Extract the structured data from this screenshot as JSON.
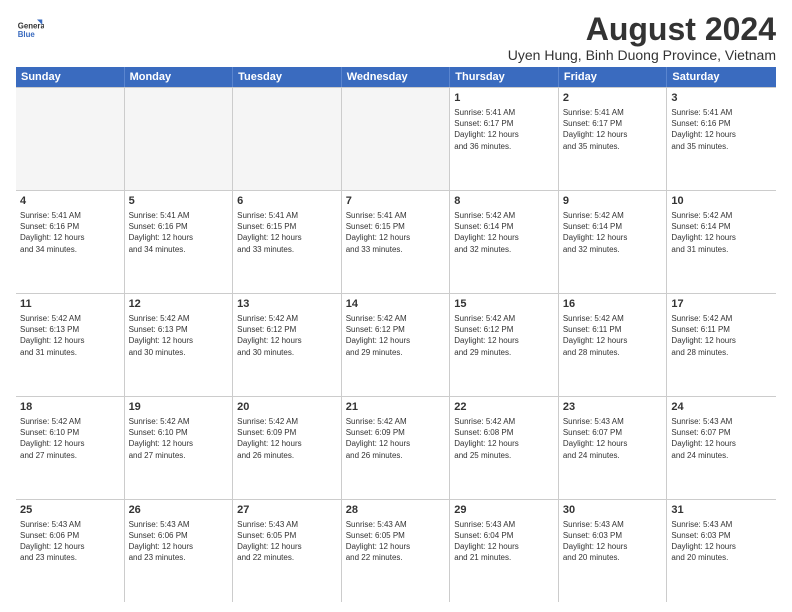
{
  "logo": {
    "line1": "General",
    "line2": "Blue"
  },
  "title": "August 2024",
  "subtitle": "Uyen Hung, Binh Duong Province, Vietnam",
  "days": [
    "Sunday",
    "Monday",
    "Tuesday",
    "Wednesday",
    "Thursday",
    "Friday",
    "Saturday"
  ],
  "weeks": [
    [
      {
        "num": "",
        "text": "",
        "empty": true
      },
      {
        "num": "",
        "text": "",
        "empty": true
      },
      {
        "num": "",
        "text": "",
        "empty": true
      },
      {
        "num": "",
        "text": "",
        "empty": true
      },
      {
        "num": "1",
        "text": "Sunrise: 5:41 AM\nSunset: 6:17 PM\nDaylight: 12 hours\nand 36 minutes."
      },
      {
        "num": "2",
        "text": "Sunrise: 5:41 AM\nSunset: 6:17 PM\nDaylight: 12 hours\nand 35 minutes."
      },
      {
        "num": "3",
        "text": "Sunrise: 5:41 AM\nSunset: 6:16 PM\nDaylight: 12 hours\nand 35 minutes."
      }
    ],
    [
      {
        "num": "4",
        "text": "Sunrise: 5:41 AM\nSunset: 6:16 PM\nDaylight: 12 hours\nand 34 minutes."
      },
      {
        "num": "5",
        "text": "Sunrise: 5:41 AM\nSunset: 6:16 PM\nDaylight: 12 hours\nand 34 minutes."
      },
      {
        "num": "6",
        "text": "Sunrise: 5:41 AM\nSunset: 6:15 PM\nDaylight: 12 hours\nand 33 minutes."
      },
      {
        "num": "7",
        "text": "Sunrise: 5:41 AM\nSunset: 6:15 PM\nDaylight: 12 hours\nand 33 minutes."
      },
      {
        "num": "8",
        "text": "Sunrise: 5:42 AM\nSunset: 6:14 PM\nDaylight: 12 hours\nand 32 minutes."
      },
      {
        "num": "9",
        "text": "Sunrise: 5:42 AM\nSunset: 6:14 PM\nDaylight: 12 hours\nand 32 minutes."
      },
      {
        "num": "10",
        "text": "Sunrise: 5:42 AM\nSunset: 6:14 PM\nDaylight: 12 hours\nand 31 minutes."
      }
    ],
    [
      {
        "num": "11",
        "text": "Sunrise: 5:42 AM\nSunset: 6:13 PM\nDaylight: 12 hours\nand 31 minutes."
      },
      {
        "num": "12",
        "text": "Sunrise: 5:42 AM\nSunset: 6:13 PM\nDaylight: 12 hours\nand 30 minutes."
      },
      {
        "num": "13",
        "text": "Sunrise: 5:42 AM\nSunset: 6:12 PM\nDaylight: 12 hours\nand 30 minutes."
      },
      {
        "num": "14",
        "text": "Sunrise: 5:42 AM\nSunset: 6:12 PM\nDaylight: 12 hours\nand 29 minutes."
      },
      {
        "num": "15",
        "text": "Sunrise: 5:42 AM\nSunset: 6:12 PM\nDaylight: 12 hours\nand 29 minutes."
      },
      {
        "num": "16",
        "text": "Sunrise: 5:42 AM\nSunset: 6:11 PM\nDaylight: 12 hours\nand 28 minutes."
      },
      {
        "num": "17",
        "text": "Sunrise: 5:42 AM\nSunset: 6:11 PM\nDaylight: 12 hours\nand 28 minutes."
      }
    ],
    [
      {
        "num": "18",
        "text": "Sunrise: 5:42 AM\nSunset: 6:10 PM\nDaylight: 12 hours\nand 27 minutes."
      },
      {
        "num": "19",
        "text": "Sunrise: 5:42 AM\nSunset: 6:10 PM\nDaylight: 12 hours\nand 27 minutes."
      },
      {
        "num": "20",
        "text": "Sunrise: 5:42 AM\nSunset: 6:09 PM\nDaylight: 12 hours\nand 26 minutes."
      },
      {
        "num": "21",
        "text": "Sunrise: 5:42 AM\nSunset: 6:09 PM\nDaylight: 12 hours\nand 26 minutes."
      },
      {
        "num": "22",
        "text": "Sunrise: 5:42 AM\nSunset: 6:08 PM\nDaylight: 12 hours\nand 25 minutes."
      },
      {
        "num": "23",
        "text": "Sunrise: 5:43 AM\nSunset: 6:07 PM\nDaylight: 12 hours\nand 24 minutes."
      },
      {
        "num": "24",
        "text": "Sunrise: 5:43 AM\nSunset: 6:07 PM\nDaylight: 12 hours\nand 24 minutes."
      }
    ],
    [
      {
        "num": "25",
        "text": "Sunrise: 5:43 AM\nSunset: 6:06 PM\nDaylight: 12 hours\nand 23 minutes."
      },
      {
        "num": "26",
        "text": "Sunrise: 5:43 AM\nSunset: 6:06 PM\nDaylight: 12 hours\nand 23 minutes."
      },
      {
        "num": "27",
        "text": "Sunrise: 5:43 AM\nSunset: 6:05 PM\nDaylight: 12 hours\nand 22 minutes."
      },
      {
        "num": "28",
        "text": "Sunrise: 5:43 AM\nSunset: 6:05 PM\nDaylight: 12 hours\nand 22 minutes."
      },
      {
        "num": "29",
        "text": "Sunrise: 5:43 AM\nSunset: 6:04 PM\nDaylight: 12 hours\nand 21 minutes."
      },
      {
        "num": "30",
        "text": "Sunrise: 5:43 AM\nSunset: 6:03 PM\nDaylight: 12 hours\nand 20 minutes."
      },
      {
        "num": "31",
        "text": "Sunrise: 5:43 AM\nSunset: 6:03 PM\nDaylight: 12 hours\nand 20 minutes."
      }
    ]
  ]
}
